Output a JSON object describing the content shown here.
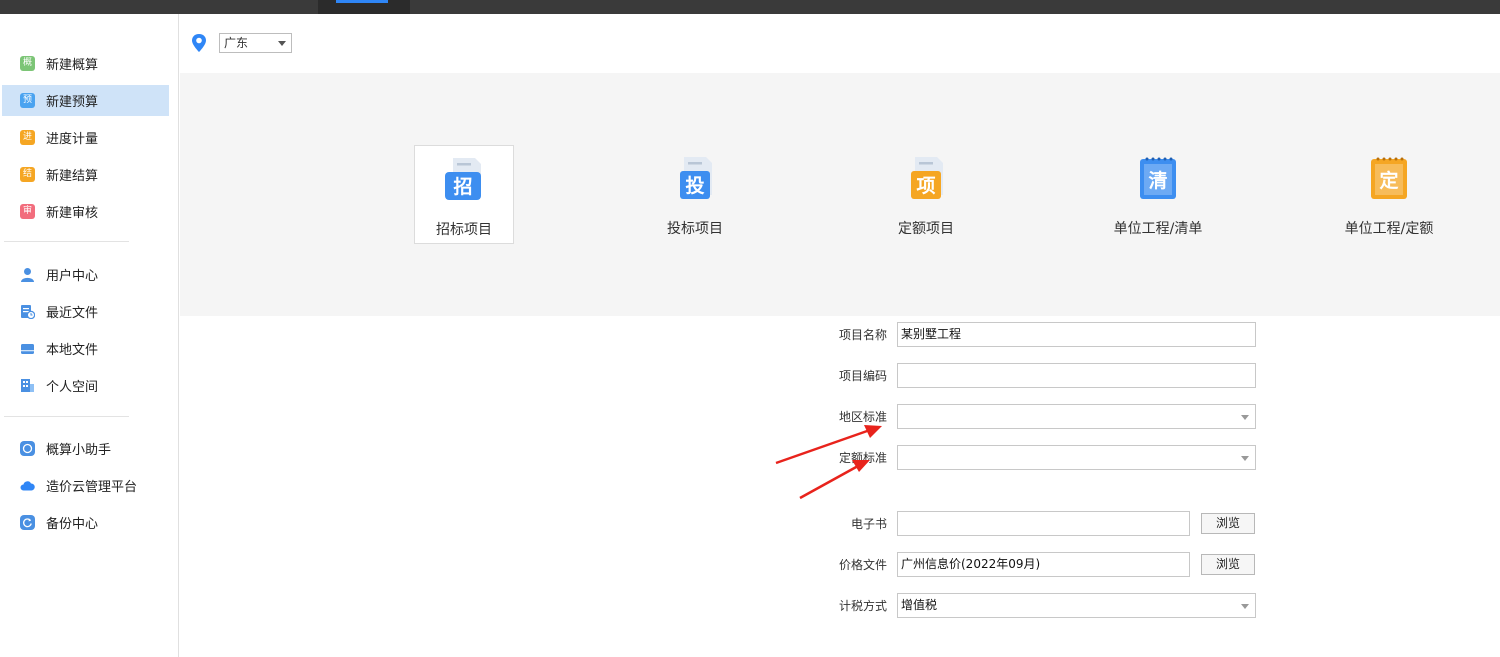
{
  "region": {
    "selected": "广东"
  },
  "sidebar": {
    "group1": [
      {
        "label": "新建概算",
        "icon": "gai-icon",
        "glyph": "概",
        "color": "#7cc576",
        "active": false
      },
      {
        "label": "新建预算",
        "icon": "yu-icon",
        "glyph": "预",
        "color": "#4aa3f0",
        "active": true
      },
      {
        "label": "进度计量",
        "icon": "jin-icon",
        "glyph": "进",
        "color": "#f5a623",
        "active": false
      },
      {
        "label": "新建结算",
        "icon": "jie-icon",
        "glyph": "结",
        "color": "#f5a623",
        "active": false
      },
      {
        "label": "新建审核",
        "icon": "shen-icon",
        "glyph": "审",
        "color": "#f26d7d",
        "active": false
      }
    ],
    "group2": [
      {
        "label": "用户中心",
        "icon": "user-icon"
      },
      {
        "label": "最近文件",
        "icon": "recent-file-icon"
      },
      {
        "label": "本地文件",
        "icon": "local-file-icon"
      },
      {
        "label": "个人空间",
        "icon": "personal-space-icon"
      }
    ],
    "group3": [
      {
        "label": "概算小助手",
        "icon": "assistant-icon"
      },
      {
        "label": "造价云管理平台",
        "icon": "cloud-icon"
      },
      {
        "label": "备份中心",
        "icon": "backup-icon"
      }
    ]
  },
  "project_types": [
    {
      "label": "招标项目",
      "glyph": "招",
      "color": "#3d8ef0",
      "selected": true
    },
    {
      "label": "投标项目",
      "glyph": "投",
      "color": "#3d8ef0",
      "selected": false
    },
    {
      "label": "定额项目",
      "glyph": "项",
      "color": "#f5a623",
      "selected": false
    },
    {
      "label": "单位工程/清单",
      "glyph": "清",
      "color": "#3d8ef0",
      "selected": false
    },
    {
      "label": "单位工程/定额",
      "glyph": "定",
      "color": "#f5a623",
      "selected": false
    }
  ],
  "form": {
    "project_name": {
      "label": "项目名称",
      "value": "某别墅工程"
    },
    "project_code": {
      "label": "项目编码",
      "value": ""
    },
    "region_standard": {
      "label": "地区标准",
      "value": ""
    },
    "quota_standard": {
      "label": "定额标准",
      "value": ""
    },
    "ebook": {
      "label": "电子书",
      "value": "",
      "button": "浏览"
    },
    "price_file": {
      "label": "价格文件",
      "value": "广州信息价(2022年09月)",
      "button": "浏览"
    },
    "tax_method": {
      "label": "计税方式",
      "value": "增值税"
    }
  },
  "colors": {
    "accent": "#2f86f6",
    "active_bg": "#cfe3f8",
    "arrow": "#e8231c"
  }
}
